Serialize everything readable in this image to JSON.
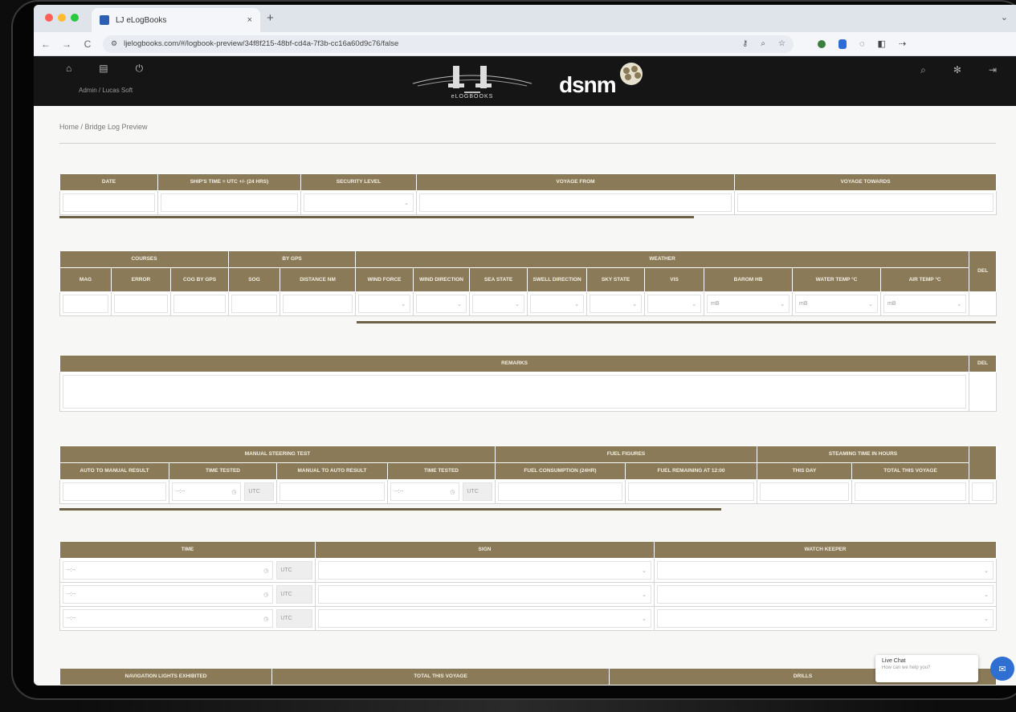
{
  "browser": {
    "tab_title": "LJ eLogBooks",
    "tab_close": "×",
    "new_tab": "+",
    "url": "ljelogbooks.com/#/logbook-preview/34f8f215-48bf-cd4a-7f3b-cc16a60d9c76/false",
    "nav": {
      "back": "←",
      "forward": "→",
      "reload": "C"
    },
    "tab_dots": [
      "#ff5f57",
      "#febc2e",
      "#28c840"
    ]
  },
  "header": {
    "user": "Admin / Lucas Soft",
    "logo_text": "eLOGBOOKS",
    "partner_logo_text": "dsnm"
  },
  "breadcrumb": "Home  /  Bridge Log Preview",
  "table1": {
    "headers": [
      "DATE",
      "SHIP'S TIME = UTC +/- (24 Hrs)",
      "SECURITY LEVEL",
      "VOYAGE FROM",
      "VOYAGE TOWARDS"
    ]
  },
  "table2": {
    "group_headers": [
      "COURSES",
      "BY GPS",
      "WEATHER"
    ],
    "headers": [
      "MAG",
      "ERROR",
      "COG BY GPS",
      "SOG",
      "DISTANCE NM",
      "WIND FORCE",
      "WIND DIRECTION",
      "SEA STATE",
      "SWELL DIRECTION",
      "SKY STATE",
      "VIS",
      "BAROM HB",
      "WATER TEMP °C",
      "AIR TEMP °C"
    ],
    "del": "DEL",
    "unit_values": [
      "mB",
      "mB",
      "mB"
    ]
  },
  "table3": {
    "headers": [
      "REMARKS"
    ],
    "del": "DEL"
  },
  "table4": {
    "group_headers": [
      "MANUAL STEERING TEST",
      "FUEL FIGURES",
      "STEAMING TIME IN HOURS"
    ],
    "headers": [
      "AUTO TO MANUAL RESULT",
      "TIME TESTED",
      "MANUAL TO AUTO RESULT",
      "TIME TESTED",
      "FUEL CONSUMPTION (24HR)",
      "FUEL REMAINING AT 12:00",
      "THIS DAY",
      "TOTAL THIS VOYAGE"
    ],
    "time_placeholder": "--:--",
    "utc_placeholder": "UTC"
  },
  "table5": {
    "headers": [
      "TIME",
      "SIGN",
      "WATCH KEEPER"
    ],
    "time_placeholder": "--:--",
    "utc_placeholder": "UTC"
  },
  "table6": {
    "headers": [
      "NAVIGATION LIGHTS EXHIBITED",
      "TOTAL THIS VOYAGE",
      "DRILLS"
    ]
  },
  "chat": {
    "title": "Live Chat",
    "subtitle": "How can we help you?"
  }
}
